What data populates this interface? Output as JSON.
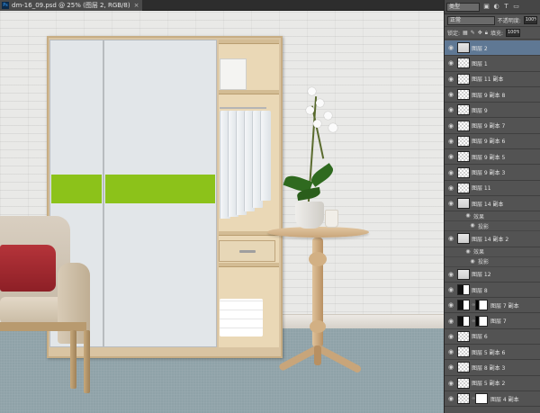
{
  "document_tab": {
    "title": "dm-16_09.psd @ 25% (图层 2, RGB/8)",
    "app_badge": "Ps",
    "close_glyph": "×"
  },
  "layers_panel": {
    "filter_kind": "类型",
    "blend_mode": "正常",
    "opacity_label": "不透明度:",
    "opacity_value": "100%",
    "lock_label": "锁定:",
    "fill_label": "填充:",
    "fill_value": "100%",
    "layers": [
      {
        "name": "图层 2",
        "selected": true
      },
      {
        "name": "图层 1"
      },
      {
        "name": "图层 11 副本"
      },
      {
        "name": "图层 9 副本 8"
      },
      {
        "name": "图层 9"
      },
      {
        "name": "图层 9 副本 7"
      },
      {
        "name": "图层 9 副本 6"
      },
      {
        "name": "图层 9 副本 5"
      },
      {
        "name": "图层 9 副本 3"
      },
      {
        "name": "图层 11"
      },
      {
        "name": "图层 14 副本",
        "effects_label": "效果",
        "effect": "投影"
      },
      {
        "name": "图层 14 副本 2",
        "effects_label": "效果",
        "effect": "投影"
      },
      {
        "name": "图层 12"
      },
      {
        "name": "图层 8"
      },
      {
        "name": "图层 7 副本",
        "has_mask": true
      },
      {
        "name": "图层 7",
        "has_mask": true
      },
      {
        "name": "图层 6"
      },
      {
        "name": "图层 5 副本 6"
      },
      {
        "name": "图层 8 副本 3"
      },
      {
        "name": "图层 5 副本 2"
      },
      {
        "name": "图层 4 副本",
        "has_mask": true
      }
    ]
  },
  "icons": {
    "eye": "eye-icon",
    "lock": "lock-icon",
    "link": "link-icon",
    "filter_pixel": "image-filter-icon",
    "filter_adjust": "adjustment-filter-icon",
    "filter_type": "type-filter-icon",
    "filter_shape": "shape-filter-icon"
  },
  "colors": {
    "selected_layer": "#5f7894",
    "panel_bg": "#535353",
    "wardrobe_stripe": "#8cc21a"
  }
}
